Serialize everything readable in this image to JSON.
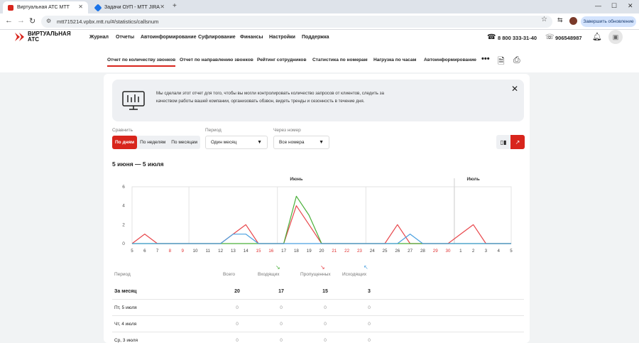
{
  "browser": {
    "tabs": [
      {
        "title": "Виртуальная АТС МТТ",
        "active": true
      },
      {
        "title": "Задачи ОУП - МТТ JIRA",
        "active": false
      }
    ],
    "url": "mtt715214.vpbx.mtt.ru/#/statistics/callsnum",
    "update_button": "Завершить обновление"
  },
  "header": {
    "logo_line1": "ВИРТУАЛЬНАЯ",
    "logo_line2": "АТС",
    "menu": [
      "Журнал",
      "Отчеты",
      "Автоинформирование",
      "Суфлирование",
      "Финансы",
      "Настройки",
      "Поддержка"
    ],
    "phone_support": "8 800 333-31-40",
    "phone_account": "906548987"
  },
  "subnav": {
    "tabs": [
      "Отчет по количеству звонков",
      "Отчет по направлению звонков",
      "Рейтинг сотрудников",
      "Статистика по номерам",
      "Нагрузка по часам",
      "Автоинформирование"
    ],
    "more": "•••"
  },
  "info": {
    "text": "Мы сделали этот отчет для того, чтобы вы могли контролировать количество запросов от клиентов, следить за качеством работы вашей компании, организовать обзвон, видеть тренды и сезонность в течение дня."
  },
  "filters": {
    "compare_label": "Сравнить",
    "compare_options": [
      "По дням",
      "По неделям",
      "По месяцам"
    ],
    "period_label": "Период",
    "period_value": "Один месяц",
    "via_label": "Через номер",
    "via_value": "Все номера"
  },
  "range_title": "5 июня — 5 июля",
  "chart_data": {
    "type": "line",
    "month_labels": [
      "Июнь",
      "Июль"
    ],
    "x": [
      "5",
      "6",
      "7",
      "8",
      "9",
      "10",
      "11",
      "12",
      "13",
      "14",
      "15",
      "16",
      "17",
      "18",
      "19",
      "20",
      "21",
      "22",
      "23",
      "24",
      "25",
      "26",
      "27",
      "28",
      "29",
      "30",
      "1",
      "2",
      "3",
      "4",
      "5"
    ],
    "x_red": [
      "8",
      "9",
      "15",
      "16",
      "21",
      "22",
      "23",
      "29",
      "30"
    ],
    "ylim": [
      0,
      6
    ],
    "yticks": [
      0,
      2,
      4,
      6
    ],
    "grid": true,
    "series": [
      {
        "color": "#e8464b",
        "values": [
          0,
          1,
          0,
          0,
          0,
          0,
          0,
          0,
          1,
          2,
          0,
          0,
          0,
          4,
          2,
          0,
          0,
          0,
          0,
          0,
          0,
          2,
          0,
          0,
          0,
          0,
          1,
          2,
          0,
          0,
          0
        ]
      },
      {
        "color": "#4ab03a",
        "values": [
          0,
          0,
          0,
          0,
          0,
          0,
          0,
          0,
          0,
          0,
          0,
          0,
          0,
          5,
          3,
          0,
          0,
          0,
          0,
          0,
          0,
          0,
          0,
          0,
          0,
          0,
          0,
          0,
          0,
          0,
          0
        ]
      },
      {
        "color": "#4aa0e0",
        "values": [
          0,
          0,
          0,
          0,
          0,
          0,
          0,
          0,
          1,
          1,
          0,
          0,
          0,
          0,
          0,
          0,
          0,
          0,
          0,
          0,
          0,
          0,
          1,
          0,
          0,
          0,
          0,
          0,
          0,
          0,
          0
        ]
      }
    ]
  },
  "table": {
    "headers": [
      "Период",
      "Всего",
      "Входящих",
      "Пропущенных",
      "Исходящих"
    ],
    "rows": [
      {
        "period": "За месяц",
        "total": "20",
        "in": "17",
        "missed": "15",
        "out": "3"
      },
      {
        "period": "Пт, 5 июля",
        "total": "0",
        "in": "0",
        "missed": "0",
        "out": "0"
      },
      {
        "period": "Чт, 4 июля",
        "total": "0",
        "in": "0",
        "missed": "0",
        "out": "0"
      },
      {
        "period": "Ср, 3 июля",
        "total": "0",
        "in": "0",
        "missed": "0",
        "out": "0"
      }
    ]
  }
}
